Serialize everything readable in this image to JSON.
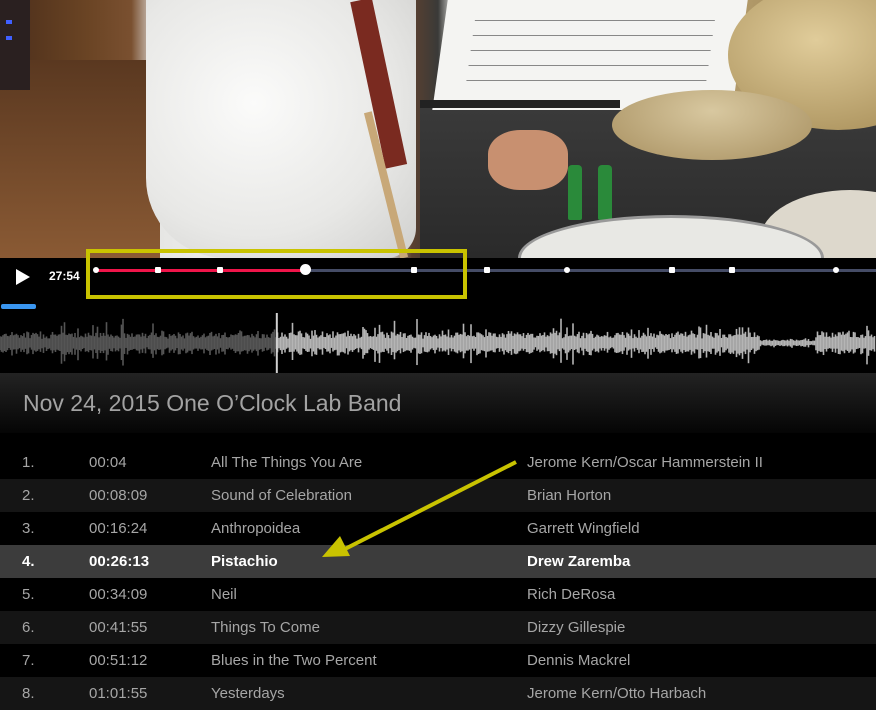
{
  "player": {
    "play_icon": "play-icon",
    "current_time": "27:54",
    "progress_fraction": 0.267,
    "colors": {
      "played": "#f0154a",
      "unplayed": "#454c66",
      "marker": "#ffffff",
      "highlight_box": "#c9c300",
      "blue_indicator": "#3a96f0"
    },
    "chapter_marker_fractions": [
      0.0,
      0.079,
      0.159,
      0.267,
      0.408,
      0.501,
      0.604,
      0.739,
      0.816,
      0.949
    ]
  },
  "waveform": {
    "played_fraction": 0.316,
    "played_color": "#555555",
    "unplayed_color": "#b5b5b5"
  },
  "concert": {
    "title": "Nov 24, 2015 One O’Clock Lab Band"
  },
  "tracks": [
    {
      "num": "1.",
      "time": "00:04",
      "title": "All The Things You Are",
      "composer": "Jerome Kern/Oscar Hammerstein II",
      "active": false
    },
    {
      "num": "2.",
      "time": "00:08:09",
      "title": "Sound of Celebration",
      "composer": "Brian Horton",
      "active": false
    },
    {
      "num": "3.",
      "time": "00:16:24",
      "title": "Anthropoidea",
      "composer": "Garrett Wingfield",
      "active": false
    },
    {
      "num": "4.",
      "time": "00:26:13",
      "title": "Pistachio",
      "composer": "Drew Zaremba",
      "active": true
    },
    {
      "num": "5.",
      "time": "00:34:09",
      "title": "Neil",
      "composer": "Rich DeRosa",
      "active": false
    },
    {
      "num": "6.",
      "time": "00:41:55",
      "title": "Things To Come",
      "composer": "Dizzy Gillespie",
      "active": false
    },
    {
      "num": "7.",
      "time": "00:51:12",
      "title": "Blues in the Two Percent",
      "composer": "Dennis Mackrel",
      "active": false
    },
    {
      "num": "8.",
      "time": "01:01:55",
      "title": "Yesterdays",
      "composer": "Jerome Kern/Otto Harbach",
      "active": false
    }
  ]
}
